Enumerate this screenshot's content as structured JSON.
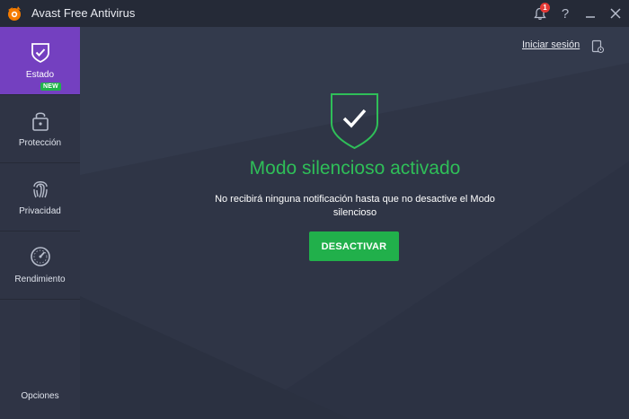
{
  "window": {
    "title": "Avast Free Antivirus",
    "notification_count": "1",
    "help_label": "?"
  },
  "sidebar": {
    "items": [
      {
        "label": "Estado",
        "icon": "shield-check-icon",
        "active": true
      },
      {
        "label": "Protección",
        "icon": "lock-icon",
        "active": false,
        "badge": "NEW"
      },
      {
        "label": "Privacidad",
        "icon": "fingerprint-icon",
        "active": false
      },
      {
        "label": "Rendimiento",
        "icon": "speedometer-icon",
        "active": false
      }
    ],
    "options_label": "Opciones"
  },
  "main": {
    "login_label": "Iniciar sesión",
    "status_title": "Modo silencioso activado",
    "status_message": "No recibirá ninguna notificación hasta que no desactive el Modo silencioso",
    "action_button": "DESACTIVAR"
  },
  "colors": {
    "accent_purple": "#7440c0",
    "success_green": "#21b04b",
    "background": "#2f3546"
  }
}
